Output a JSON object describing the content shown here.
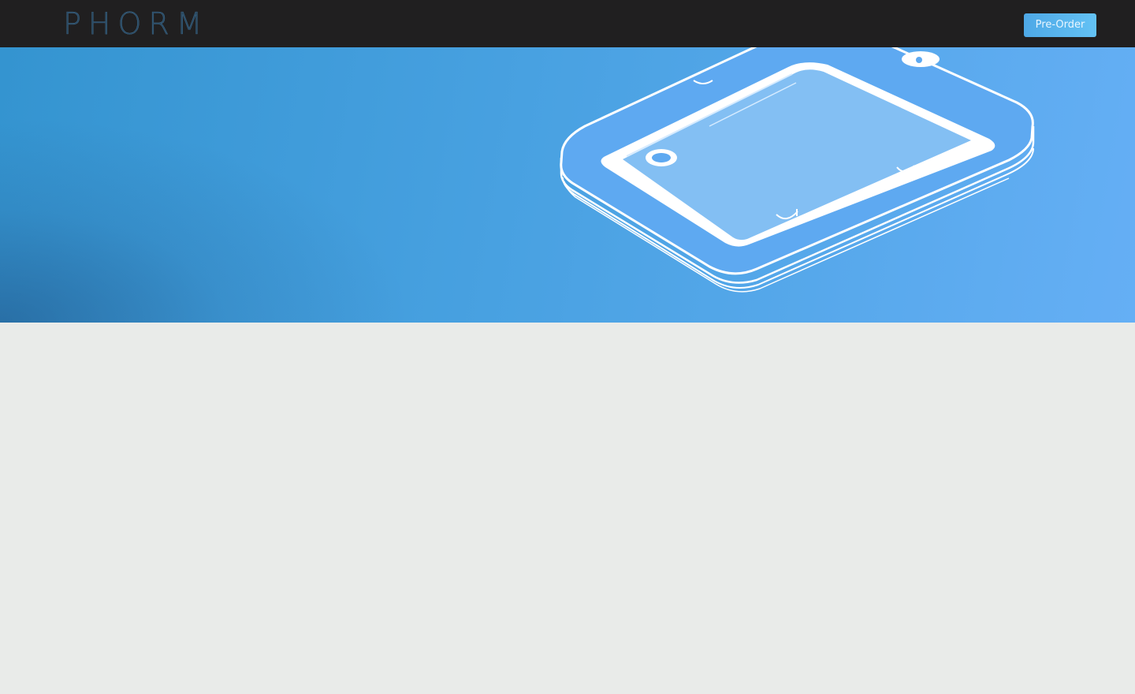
{
  "header": {
    "logo_text": "PHORM",
    "preorder_label": "Pre-Order"
  },
  "hero": {
    "illustration": "tablet-outline-illustration"
  },
  "colors": {
    "topbar": "#201f20",
    "hero_start": "#3494d0",
    "hero_end": "#65aff5",
    "button": "#4ea8e6",
    "page_bg": "#e9ebe9"
  }
}
